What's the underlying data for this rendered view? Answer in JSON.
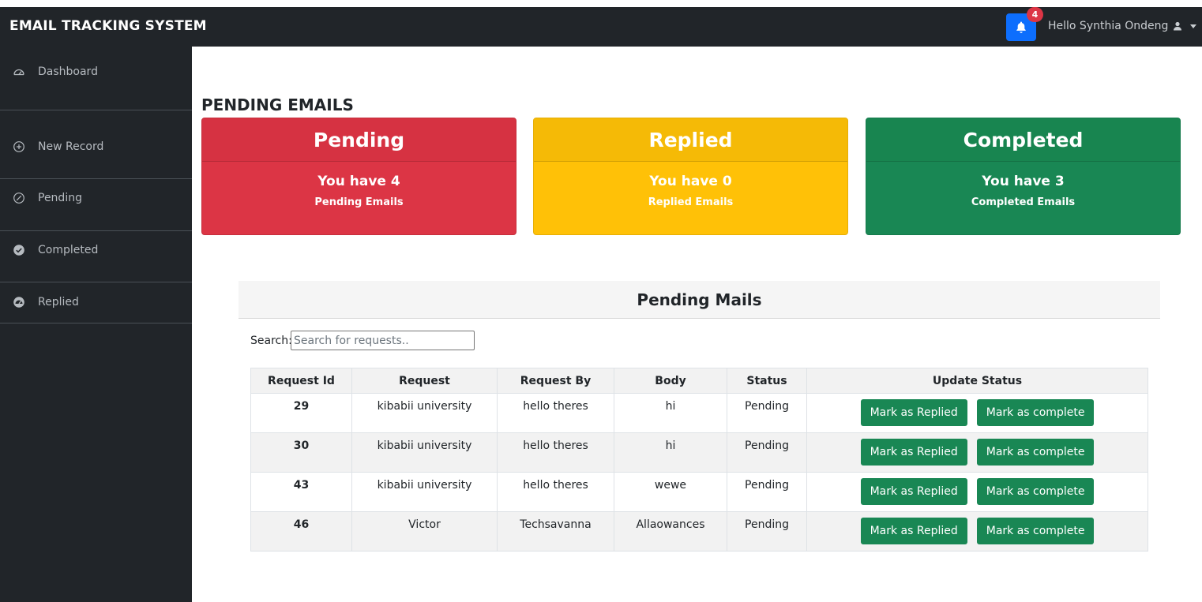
{
  "navbar": {
    "brand": "EMAIL TRACKING SYSTEM",
    "notification_count": "4",
    "greeting": "Hello Synthia Ondeng",
    "accent_color": "#0d6efd"
  },
  "sidebar": {
    "items": [
      {
        "label": "Dashboard",
        "icon": "dashboard-icon"
      },
      {
        "label": "New Record",
        "icon": "plus-circle-icon"
      },
      {
        "label": "Pending",
        "icon": "slash-circle-icon"
      },
      {
        "label": "Completed",
        "icon": "check-circle-icon"
      },
      {
        "label": "Replied",
        "icon": "speedometer-icon"
      }
    ]
  },
  "main": {
    "title": "PENDING EMAILS",
    "cards": [
      {
        "title": "Pending",
        "line1": "You have 4",
        "line2": "Pending Emails",
        "color": "#dc3545"
      },
      {
        "title": "Replied",
        "line1": "You have 0",
        "line2": "Replied Emails",
        "color": "#ffc107"
      },
      {
        "title": "Completed",
        "line1": "You have 3",
        "line2": "Completed Emails",
        "color": "#198754"
      }
    ]
  },
  "panel": {
    "title": "Pending Mails",
    "search_label": "Search:",
    "search_placeholder": "Search for requests..",
    "columns": [
      "Request Id",
      "Request",
      "Request By",
      "Body",
      "Status",
      "Update Status"
    ],
    "rows": [
      {
        "id": "29",
        "request": "kibabii university",
        "request_by": "hello theres",
        "body": "hi",
        "status": "Pending"
      },
      {
        "id": "30",
        "request": "kibabii university",
        "request_by": "hello theres",
        "body": "hi",
        "status": "Pending"
      },
      {
        "id": "43",
        "request": "kibabii university",
        "request_by": "hello theres",
        "body": "wewe",
        "status": "Pending"
      },
      {
        "id": "46",
        "request": "Victor",
        "request_by": "Techsavanna",
        "body": "Allaowances",
        "status": "Pending"
      }
    ],
    "mark_replied_label": "Mark as Replied",
    "mark_complete_label": "Mark as complete",
    "button_color": "#198754"
  }
}
